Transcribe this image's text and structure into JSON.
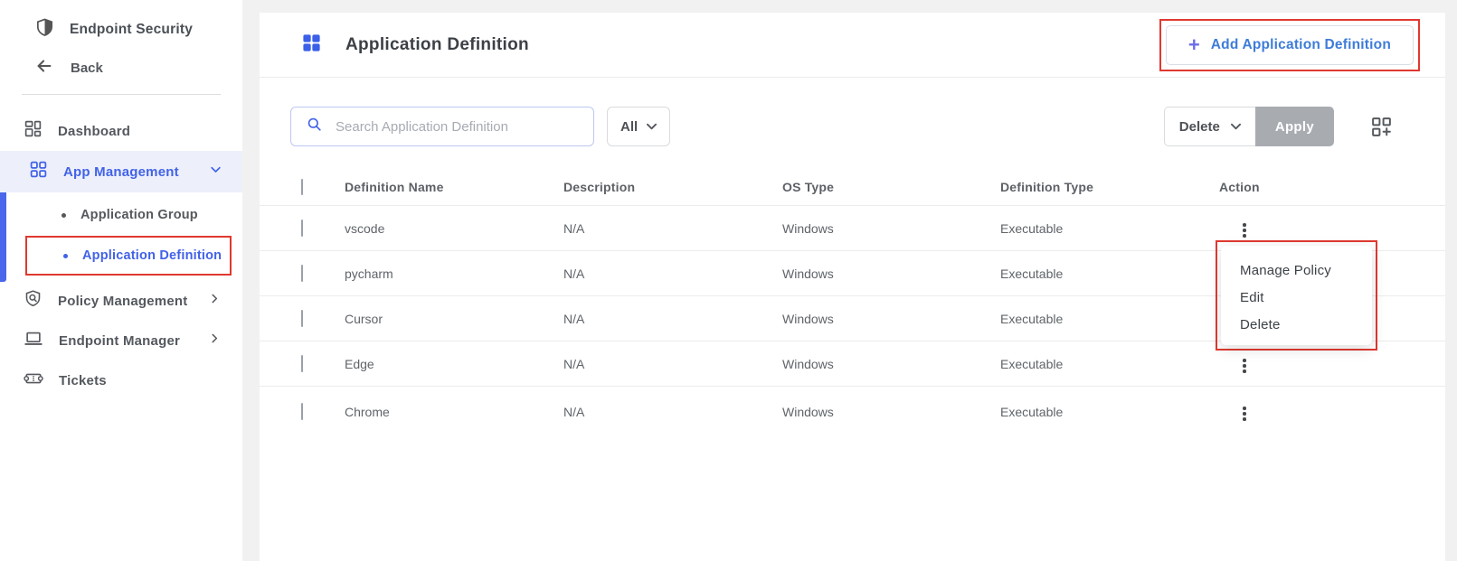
{
  "sidebar": {
    "brand": {
      "label": "Endpoint Security"
    },
    "back_label": "Back",
    "items": [
      {
        "label": "Dashboard"
      },
      {
        "label": "App Management"
      },
      {
        "label": "Application Group"
      },
      {
        "label": "Application Definition"
      },
      {
        "label": "Policy Management"
      },
      {
        "label": "Endpoint Manager"
      },
      {
        "label": "Tickets"
      }
    ]
  },
  "header": {
    "title": "Application Definition",
    "add_button": {
      "plus": "+",
      "label": "Add Application Definition"
    }
  },
  "toolbar": {
    "search_placeholder": "Search Application Definition",
    "filter_selected": "All",
    "bulk_action_label": "Delete",
    "apply_label": "Apply"
  },
  "table": {
    "columns": [
      "Definition Name",
      "Description",
      "OS Type",
      "Definition Type",
      "Action"
    ],
    "rows": [
      {
        "name": "vscode",
        "description": "N/A",
        "os": "Windows",
        "type": "Executable"
      },
      {
        "name": "pycharm",
        "description": "N/A",
        "os": "Windows",
        "type": "Executable"
      },
      {
        "name": "Cursor",
        "description": "N/A",
        "os": "Windows",
        "type": "Executable"
      },
      {
        "name": "Edge",
        "description": "N/A",
        "os": "Windows",
        "type": "Executable"
      },
      {
        "name": "Chrome",
        "description": "N/A",
        "os": "Windows",
        "type": "Executable"
      }
    ]
  },
  "context_menu": {
    "items": [
      "Manage Policy",
      "Edit",
      "Delete"
    ]
  },
  "colors": {
    "accent_blue": "#4262e8",
    "annotation_red": "#e0392f",
    "apply_gray": "#a8acb1",
    "add_link_blue": "#3d7cd9"
  }
}
